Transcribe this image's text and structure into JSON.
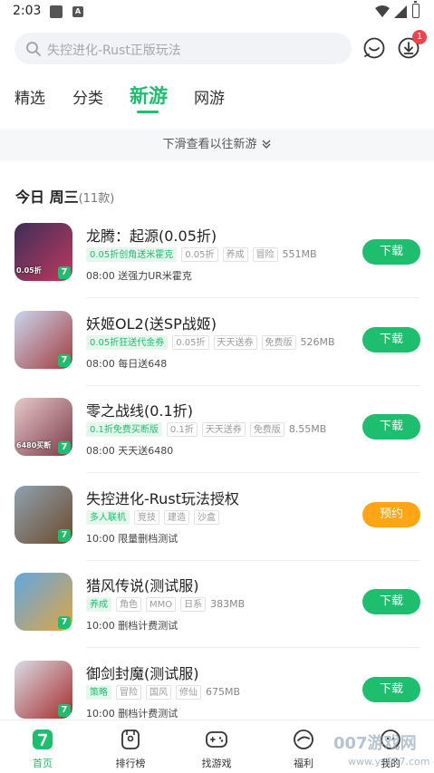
{
  "status_bar": {
    "time": "2:03",
    "notif_icon_letter": "A"
  },
  "search": {
    "placeholder": "失控进化-Rust正版玩法"
  },
  "header": {
    "download_badge": "1"
  },
  "tabs": [
    {
      "label": "精选"
    },
    {
      "label": "分类"
    },
    {
      "label": "新游",
      "active": true
    },
    {
      "label": "网游"
    }
  ],
  "banner": {
    "text": "下滑查看以往新游"
  },
  "section": {
    "title": "今日 周三",
    "count": "(11款)"
  },
  "games": [
    {
      "title": "龙腾：起源(0.05折)",
      "highlight": "0.05折创角送米霍克",
      "tags": [
        "0.05折",
        "养成",
        "冒险"
      ],
      "size": "551MB",
      "desc": "08:00  送强力UR米霍克",
      "button": "下载",
      "icon_text": "0.05折",
      "icon_colors": [
        "#3b2f5a",
        "#c2385d"
      ]
    },
    {
      "title": "妖姬OL2(送SP战姬)",
      "highlight": "0.05折狂送代金券",
      "tags": [
        "0.05折",
        "天天送券",
        "免费版"
      ],
      "size": "526MB",
      "desc": "08:00  每日送648",
      "button": "下载",
      "icon_text": "",
      "icon_colors": [
        "#c9d7ee",
        "#a43b3f"
      ]
    },
    {
      "title": "零之战线(0.1折)",
      "highlight": "0.1折免费买断版",
      "tags": [
        "0.1折",
        "天天送券",
        "免费版"
      ],
      "size": "8.55MB",
      "desc": "08:00  天天送6480",
      "button": "下载",
      "icon_text": "6480买断",
      "icon_colors": [
        "#e8c9c9",
        "#7a3b4a"
      ]
    },
    {
      "title": "失控进化-Rust玩法授权",
      "highlight": "多人联机",
      "tags": [
        "竞技",
        "建造",
        "沙盒"
      ],
      "size": "",
      "desc": "10:00  限量删档测试",
      "button": "预约",
      "reserve": true,
      "icon_text": "",
      "icon_colors": [
        "#8fa2b0",
        "#6d4a2c"
      ]
    },
    {
      "title": "猎风传说(测试服)",
      "highlight": "养成",
      "tags": [
        "角色",
        "MMO",
        "日系"
      ],
      "size": "383MB",
      "desc": "10:00  删档计费测试",
      "button": "下载",
      "icon_text": "",
      "icon_colors": [
        "#5fa8e0",
        "#e0a444"
      ]
    },
    {
      "title": "御剑封魔(测试服)",
      "highlight": "策略",
      "tags": [
        "冒险",
        "国风",
        "修仙"
      ],
      "size": "675MB",
      "desc": "10:00  删档计费测试",
      "button": "下载",
      "icon_text": "",
      "icon_colors": [
        "#d8dde6",
        "#a72b2b"
      ]
    }
  ],
  "nav": [
    {
      "label": "首页",
      "icon": "home-icon",
      "active": true
    },
    {
      "label": "排行榜",
      "icon": "ranking-icon"
    },
    {
      "label": "找游戏",
      "icon": "gamepad-icon"
    },
    {
      "label": "福利",
      "icon": "gift-icon"
    },
    {
      "label": "我的",
      "icon": "profile-icon"
    }
  ],
  "watermark": {
    "main": "007游戏网",
    "sub": "www.yx007.com"
  },
  "colors": {
    "accent": "#1dbf6e",
    "reserve": "#ffa516",
    "badge": "#f2414a"
  }
}
